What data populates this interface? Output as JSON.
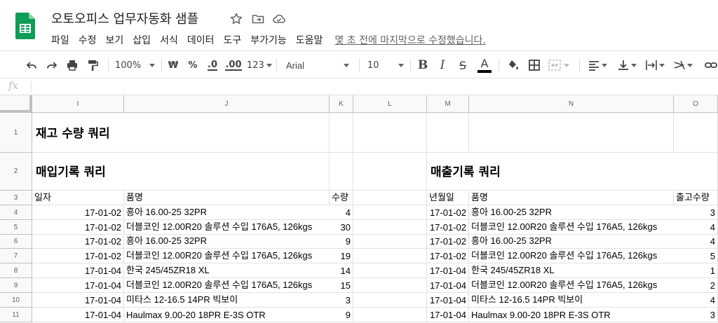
{
  "document": {
    "title": "오토오피스 업무자동화 샘플",
    "last_edit": "몇 초 전에 마지막으로 수정했습니다."
  },
  "menu": [
    "파일",
    "수정",
    "보기",
    "삽입",
    "서식",
    "데이터",
    "도구",
    "부가기능",
    "도움말"
  ],
  "toolbar": {
    "zoom": "100%",
    "currency": "₩",
    "percent": "%",
    "decimal_decrease": ".0",
    "decimal_increase": ".00",
    "more_formats": "123",
    "font": "Arial",
    "font_size": "10"
  },
  "formula_bar": {
    "fx": "fx",
    "value": ""
  },
  "columns": [
    "I",
    "J",
    "K",
    "L",
    "M",
    "N",
    "O"
  ],
  "rows": [
    "1",
    "2",
    "3",
    "4",
    "5",
    "6",
    "7",
    "8",
    "9",
    "10",
    "11"
  ],
  "sheet": {
    "title": "재고 수량 쿼리",
    "purchase": {
      "heading": "매입기록 쿼리",
      "headers": [
        "일자",
        "품명",
        "수량"
      ],
      "rows": [
        [
          "17-01-02",
          "흥아 16.00-25 32PR",
          "4"
        ],
        [
          "17-01-02",
          "더블코인 12.00R20 솔루션 수입 176A5, 126kgs",
          "30"
        ],
        [
          "17-01-02",
          "흥아 16.00-25 32PR",
          "9"
        ],
        [
          "17-01-02",
          "더블코인 12.00R20 솔루션 수입 176A5, 126kgs",
          "19"
        ],
        [
          "17-01-04",
          "한국 245/45ZR18 XL",
          "14"
        ],
        [
          "17-01-04",
          "더블코인 12.00R20 솔루션 수입 176A5, 126kgs",
          "15"
        ],
        [
          "17-01-04",
          "미타스 12-16.5 14PR 빅보이",
          "3"
        ],
        [
          "17-01-04",
          "Haulmax 9.00-20 18PR E-3S OTR",
          "9"
        ]
      ]
    },
    "sales": {
      "heading": "매출기록 쿼리",
      "headers": [
        "년월일",
        "품명",
        "출고수량"
      ],
      "rows": [
        [
          "17-01-02",
          "흥아 16.00-25 32PR",
          "3"
        ],
        [
          "17-01-02",
          "더블코인 12.00R20 솔루션 수입 176A5, 126kgs",
          "4"
        ],
        [
          "17-01-02",
          "흥아 16.00-25 32PR",
          "4"
        ],
        [
          "17-01-02",
          "더블코인 12.00R20 솔루션 수입 176A5, 126kgs",
          "5"
        ],
        [
          "17-01-04",
          "한국 245/45ZR18 XL",
          "1"
        ],
        [
          "17-01-04",
          "더블코인 12.00R20 솔루션 수입 176A5, 126kgs",
          "2"
        ],
        [
          "17-01-04",
          "미타스 12-16.5 14PR 빅보이",
          "4"
        ],
        [
          "17-01-04",
          "Haulmax 9.00-20 18PR E-3S OTR",
          "3"
        ]
      ]
    }
  },
  "colors": {
    "brand": "#0f9d58",
    "header_bg": "#f8f9fa",
    "grid_line": "#e2e2e2"
  }
}
